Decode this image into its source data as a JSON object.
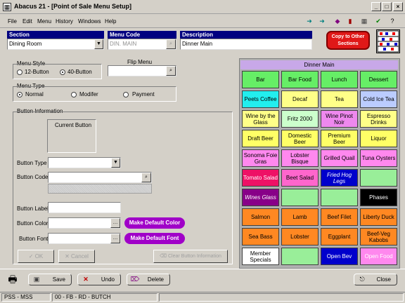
{
  "window": {
    "title": "Abacus 21 - [Point of Sale Menu Setup]"
  },
  "menubar": [
    "File",
    "Edit",
    "Menu",
    "History",
    "Windows",
    "Help"
  ],
  "header": {
    "section_label": "Section",
    "section_value": "Dining Room",
    "menucode_label": "Menu Code",
    "menucode_value": "DIN. MAIN",
    "description_label": "Description",
    "description_value": "Dinner Main",
    "copy_button": "Copy to Other Sections"
  },
  "menu_style": {
    "label": "Menu Style",
    "opt12": "12-Button",
    "opt40": "40-Button",
    "selected": "40-Button"
  },
  "flip_menu": {
    "label": "Flip Menu",
    "value": ""
  },
  "menu_type": {
    "label": "Menu Type",
    "normal": "Normal",
    "modifier": "Modifer",
    "payment": "Payment",
    "selected": "Normal"
  },
  "button_info": {
    "label": "Button Information",
    "current_button": "Current Button",
    "type_label": "Button Type",
    "code_label": "Button Code",
    "blabel_label": "Button Label",
    "color_label": "Button Color",
    "font_label": "Button Font",
    "default_color": "Make Default Color",
    "default_font": "Make Default Font",
    "ok": "OK",
    "cancel": "Cancel",
    "clear": "Clear Button Information"
  },
  "menu_grid": {
    "title": "Dinner Main",
    "buttons": [
      {
        "label": "Bar",
        "bg": "#66ee66",
        "fg": "#000000",
        "italic": false
      },
      {
        "label": "Bar Food",
        "bg": "#66ee66",
        "fg": "#000000",
        "italic": false
      },
      {
        "label": "Lunch",
        "bg": "#66ee66",
        "fg": "#000000",
        "italic": false
      },
      {
        "label": "Dessert",
        "bg": "#66ee66",
        "fg": "#000000",
        "italic": false
      },
      {
        "label": "Peets Coffee",
        "bg": "#22eeee",
        "fg": "#000000",
        "italic": false
      },
      {
        "label": "Decaf",
        "bg": "#ffff88",
        "fg": "#000000",
        "italic": false
      },
      {
        "label": "Tea",
        "bg": "#ffff88",
        "fg": "#000000",
        "italic": false
      },
      {
        "label": "Cold Ice Tea",
        "bg": "#bbccff",
        "fg": "#000000",
        "italic": false
      },
      {
        "label": "Wine by the Glass",
        "bg": "#ffff88",
        "fg": "#000000",
        "italic": false
      },
      {
        "label": "Fritz 2000",
        "bg": "#ccffcc",
        "fg": "#000000",
        "italic": false
      },
      {
        "label": "Wine Pinot Noir",
        "bg": "#ee88ee",
        "fg": "#000000",
        "italic": false
      },
      {
        "label": "Espresso Drinks",
        "bg": "#ffff88",
        "fg": "#000000",
        "italic": false
      },
      {
        "label": "Draft Beer",
        "bg": "#ffff66",
        "fg": "#000000",
        "italic": false
      },
      {
        "label": "Domestic Beer",
        "bg": "#ffff66",
        "fg": "#000000",
        "italic": false
      },
      {
        "label": "Premium Beer",
        "bg": "#ffff66",
        "fg": "#000000",
        "italic": false
      },
      {
        "label": "Liquor",
        "bg": "#ffff66",
        "fg": "#000000",
        "italic": false
      },
      {
        "label": "Sonoma Foie Gras",
        "bg": "#ff88ee",
        "fg": "#000000",
        "italic": false
      },
      {
        "label": "Lobster Bisque",
        "bg": "#ff88ee",
        "fg": "#000000",
        "italic": false
      },
      {
        "label": "Grilled Quail",
        "bg": "#ff88ee",
        "fg": "#000000",
        "italic": false
      },
      {
        "label": "Tuna Oysters",
        "bg": "#ff88ee",
        "fg": "#000000",
        "italic": false
      },
      {
        "label": "Tomato Salad",
        "bg": "#ee1166",
        "fg": "#ffffff",
        "italic": false
      },
      {
        "label": "Beet Salad",
        "bg": "#ff66cc",
        "fg": "#000000",
        "italic": false
      },
      {
        "label": "Fried Hog Legs",
        "bg": "#0000cc",
        "fg": "#ffffff",
        "italic": true
      },
      {
        "label": "",
        "bg": "#99ee99",
        "fg": "#000000",
        "italic": false
      },
      {
        "label": "Wines Glass",
        "bg": "#880088",
        "fg": "#ffffff",
        "italic": true
      },
      {
        "label": "",
        "bg": "#99ee99",
        "fg": "#000000",
        "italic": false
      },
      {
        "label": "",
        "bg": "#99ee99",
        "fg": "#000000",
        "italic": false
      },
      {
        "label": "Phases",
        "bg": "#000000",
        "fg": "#ffffff",
        "italic": false
      },
      {
        "label": "Salmon",
        "bg": "#ff8822",
        "fg": "#000000",
        "italic": false
      },
      {
        "label": "Lamb",
        "bg": "#ff8822",
        "fg": "#000000",
        "italic": false
      },
      {
        "label": "Beef Filet",
        "bg": "#ff8822",
        "fg": "#000000",
        "italic": false
      },
      {
        "label": "Liberty Duck",
        "bg": "#ff8822",
        "fg": "#000000",
        "italic": false
      },
      {
        "label": "Sea Bass",
        "bg": "#ff8822",
        "fg": "#000000",
        "italic": false
      },
      {
        "label": "Lobster",
        "bg": "#ff8822",
        "fg": "#000000",
        "italic": false
      },
      {
        "label": "Eggplant",
        "bg": "#ff8822",
        "fg": "#000000",
        "italic": false
      },
      {
        "label": "Beef-Veg Kabobs",
        "bg": "#ff8822",
        "fg": "#000000",
        "italic": false
      },
      {
        "label": "Member Specials",
        "bg": "#ffffff",
        "fg": "#000000",
        "italic": false
      },
      {
        "label": "",
        "bg": "#99ee99",
        "fg": "#000000",
        "italic": false
      },
      {
        "label": "Open Bev",
        "bg": "#0000cc",
        "fg": "#ffffff",
        "italic": false
      },
      {
        "label": "Open Food",
        "bg": "#ff88ee",
        "fg": "#ffffff",
        "italic": false
      }
    ]
  },
  "bottom": {
    "save": "Save",
    "undo": "Undo",
    "delete": "Delete",
    "close": "Close"
  },
  "status": {
    "cell1": "PSS - MSS",
    "cell2": "00 - FB - RD - BUTCH"
  }
}
